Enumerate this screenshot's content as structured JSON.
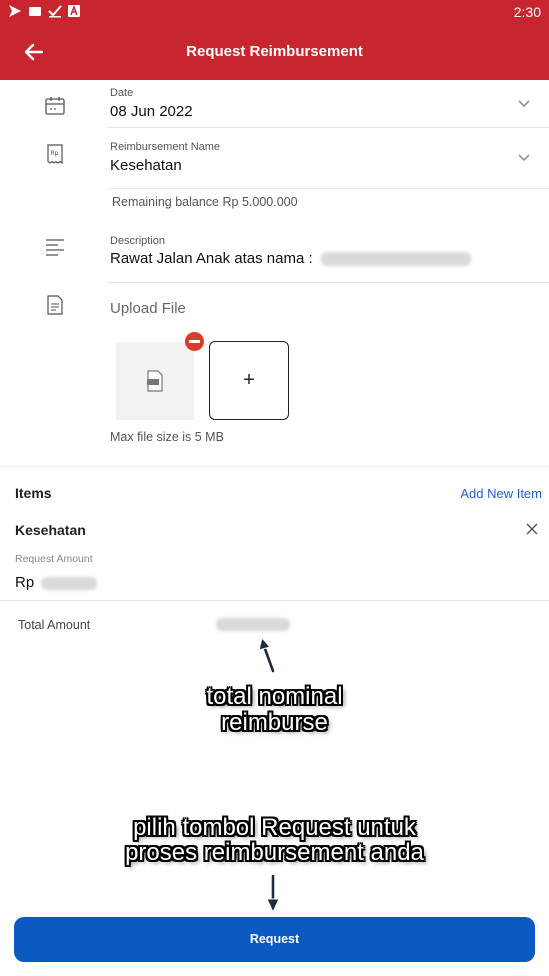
{
  "status_bar": {
    "time": "2:30"
  },
  "header": {
    "title": "Request Reimbursement"
  },
  "form": {
    "date": {
      "label": "Date",
      "value": "08 Jun 2022"
    },
    "reimbursement_name": {
      "label": "Reimbursement Name",
      "value": "Kesehatan"
    },
    "remaining_balance": "Remaining balance  Rp 5.000.000",
    "description": {
      "label": "Description",
      "value": "Rawat Jalan Anak atas nama :"
    },
    "upload": {
      "label": "Upload File",
      "add_symbol": "+",
      "max_size_text": "Max file size is 5 MB"
    }
  },
  "items": {
    "title": "Items",
    "add_label": "Add New Item",
    "entries": [
      {
        "name": "Kesehatan",
        "amount_label": "Request Amount",
        "currency": "Rp"
      }
    ]
  },
  "total": {
    "label": "Total Amount"
  },
  "annotations": {
    "total_note_line1": "total nominal",
    "total_note_line2": "reimburse",
    "request_note_line1": "pilih tombol Request untuk",
    "request_note_line2": "proses reimbursement anda"
  },
  "actions": {
    "request_label": "Request"
  },
  "colors": {
    "appbar": "#c8262f",
    "primary_button": "#0a5ac2",
    "link": "#1f5fd3",
    "remove": "#de3a2c"
  }
}
